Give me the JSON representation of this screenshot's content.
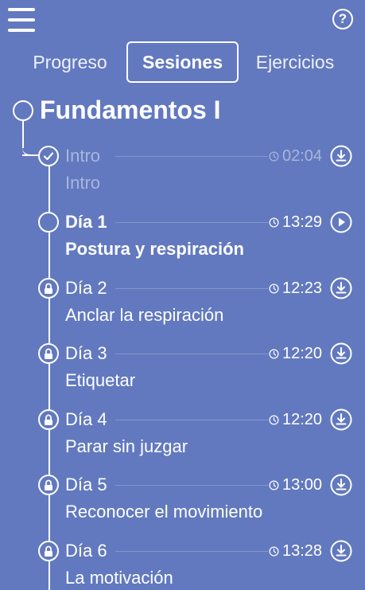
{
  "header": {
    "menu_icon": "hamburger-menu-icon",
    "help_icon": "help-question-icon",
    "help_glyph": "?"
  },
  "tabs": [
    {
      "label": "Progreso",
      "active": false
    },
    {
      "label": "Sesiones",
      "active": true
    },
    {
      "label": "Ejercicios",
      "active": false
    }
  ],
  "section": {
    "title": "Fundamentos I"
  },
  "sessions": [
    {
      "day": "Intro",
      "title": "Intro",
      "duration": "02:04",
      "status": "completed",
      "action_icon": "download-icon"
    },
    {
      "day": "Día 1",
      "title": "Postura y respiración",
      "duration": "13:29",
      "status": "current",
      "action_icon": "play-icon"
    },
    {
      "day": "Día 2",
      "title": "Anclar la respiración",
      "duration": "12:23",
      "status": "locked",
      "action_icon": "download-icon"
    },
    {
      "day": "Día 3",
      "title": "Etiquetar",
      "duration": "12:20",
      "status": "locked",
      "action_icon": "download-icon"
    },
    {
      "day": "Día 4",
      "title": "Parar sin juzgar",
      "duration": "12:20",
      "status": "locked",
      "action_icon": "download-icon"
    },
    {
      "day": "Día 5",
      "title": "Reconocer el movimiento",
      "duration": "13:00",
      "status": "locked",
      "action_icon": "download-icon"
    },
    {
      "day": "Día 6",
      "title": "La motivación",
      "duration": "13:28",
      "status": "locked",
      "action_icon": "download-icon"
    }
  ],
  "colors": {
    "background": "#6279bf",
    "foreground": "#ffffff"
  }
}
